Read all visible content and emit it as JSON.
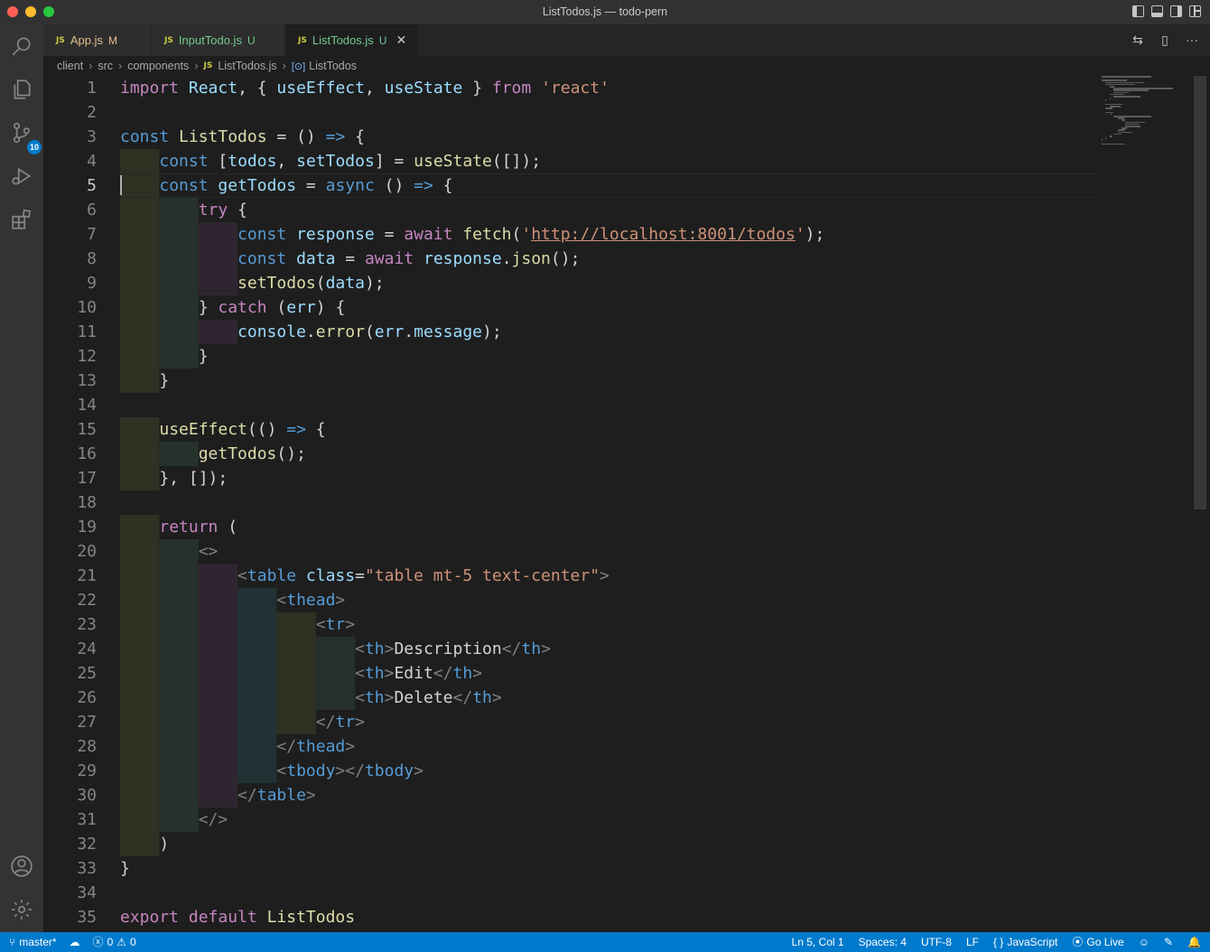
{
  "window": {
    "title": "ListTodos.js — todo-pern"
  },
  "activity_bar": {
    "items": [
      "search-icon",
      "explorer-icon",
      "source-control-icon",
      "run-debug-icon",
      "extensions-icon"
    ],
    "source_control_badge": "10",
    "bottom": [
      "account-icon",
      "manage-gear-icon"
    ]
  },
  "tabs": [
    {
      "name": "App.js",
      "status": "M",
      "active": false
    },
    {
      "name": "InputTodo.js",
      "status": "U",
      "active": false
    },
    {
      "name": "ListTodos.js",
      "status": "U",
      "active": true
    }
  ],
  "breadcrumb": [
    "client",
    "src",
    "components",
    "ListTodos.js",
    "ListTodos"
  ],
  "editor": {
    "lines": [
      "import React, { useEffect, useState } from 'react'",
      "",
      "const ListTodos = () => {",
      "    const [todos, setTodos] = useState([]);",
      "    const getTodos = async () => {",
      "        try {",
      "            const response = await fetch('http://localhost:8001/todos');",
      "            const data = await response.json();",
      "            setTodos(data);",
      "        } catch (err) {",
      "            console.error(err.message);",
      "        }",
      "    }",
      "",
      "    useEffect(() => {",
      "        getTodos();",
      "    }, []);",
      "",
      "    return (",
      "        <>",
      "            <table class=\"table mt-5 text-center\">",
      "                <thead>",
      "                    <tr>",
      "                        <th>Description</th>",
      "                        <th>Edit</th>",
      "                        <th>Delete</th>",
      "                    </tr>",
      "                </thead>",
      "                <tbody></tbody>",
      "            </table>",
      "        </>",
      "    )",
      "}",
      "",
      "export default ListTodos"
    ],
    "current_line": 5
  },
  "statusbar": {
    "branch": "master*",
    "errors": "0",
    "warnings": "0",
    "position": "Ln 5, Col 1",
    "spaces": "Spaces: 4",
    "encoding": "UTF-8",
    "eol": "LF",
    "language": "JavaScript",
    "go_live": "Go Live"
  }
}
